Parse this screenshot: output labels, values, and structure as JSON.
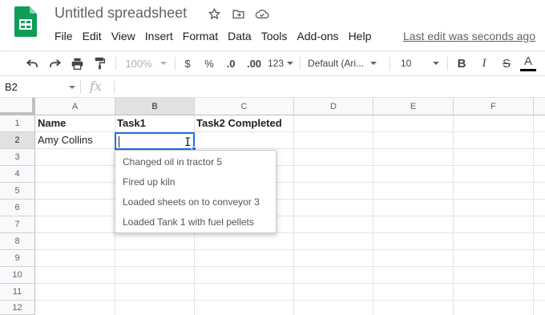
{
  "app": {
    "title": "Untitled spreadsheet",
    "last_edit": "Last edit was seconds ago"
  },
  "header_icons": [
    "star-icon",
    "move-to-folder-icon",
    "cloud-saved-icon"
  ],
  "menu": [
    "File",
    "Edit",
    "View",
    "Insert",
    "Format",
    "Data",
    "Tools",
    "Add-ons",
    "Help"
  ],
  "toolbar": {
    "zoom": "100%",
    "currency": "$",
    "percent": "%",
    "decrease_decimal": ".0",
    "increase_decimal": ".00",
    "more_formats": "123",
    "font": "Default (Ari...",
    "font_size": "10",
    "bold": "B",
    "italic": "I",
    "strikethrough": "S",
    "text_color": "A",
    "text_color_value": "#000000"
  },
  "formula_bar": {
    "cell_ref": "B2",
    "fx": "fx",
    "value": ""
  },
  "columns": [
    "A",
    "B",
    "C",
    "D",
    "E",
    "F"
  ],
  "rows": [
    "1",
    "2",
    "3",
    "4",
    "5",
    "6",
    "7",
    "8",
    "9",
    "10",
    "11",
    "12"
  ],
  "cells": {
    "A1": "Name",
    "B1": "Task1",
    "C1": "Task2 Completed",
    "A2": "Amy Collins"
  },
  "autocomplete": [
    "Changed oil in tractor 5",
    "Fired up kiln",
    "Loaded sheets on to conveyor 3",
    "Loaded Tank 1 with fuel pellets"
  ],
  "colors": {
    "accent": "#1a73e8",
    "sheets_green": "#0f9d58"
  }
}
